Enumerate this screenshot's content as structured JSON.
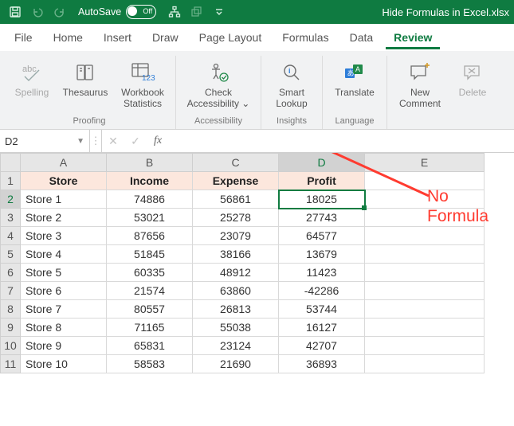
{
  "titlebar": {
    "autosave_label": "AutoSave",
    "autosave_state": "Off",
    "filename": "Hide Formulas in Excel.xlsx"
  },
  "tabs": [
    {
      "id": "file",
      "label": "File"
    },
    {
      "id": "home",
      "label": "Home"
    },
    {
      "id": "insert",
      "label": "Insert"
    },
    {
      "id": "draw",
      "label": "Draw"
    },
    {
      "id": "pagelayout",
      "label": "Page Layout"
    },
    {
      "id": "formulas",
      "label": "Formulas"
    },
    {
      "id": "data",
      "label": "Data"
    },
    {
      "id": "review",
      "label": "Review",
      "active": true
    }
  ],
  "ribbon": {
    "groups": {
      "proofing": {
        "label": "Proofing",
        "spelling": "Spelling",
        "thesaurus": "Thesaurus",
        "workbook_stats": "Workbook\nStatistics"
      },
      "accessibility": {
        "label": "Accessibility",
        "check": "Check\nAccessibility ⌄"
      },
      "insights": {
        "label": "Insights",
        "smartlookup": "Smart\nLookup"
      },
      "language": {
        "label": "Language",
        "translate": "Translate"
      },
      "comments": {
        "newcomment": "New\nComment",
        "delete": "Delete"
      }
    }
  },
  "formula_bar": {
    "cell_ref": "D2",
    "fx_label": "fx",
    "content": ""
  },
  "columns": [
    "A",
    "B",
    "C",
    "D",
    "E"
  ],
  "headers": {
    "A": "Store",
    "B": "Income",
    "C": "Expense",
    "D": "Profit"
  },
  "rows": [
    {
      "n": 2,
      "store": "Store 1",
      "income": 74886,
      "expense": 56861,
      "profit": 18025
    },
    {
      "n": 3,
      "store": "Store 2",
      "income": 53021,
      "expense": 25278,
      "profit": 27743
    },
    {
      "n": 4,
      "store": "Store 3",
      "income": 87656,
      "expense": 23079,
      "profit": 64577
    },
    {
      "n": 5,
      "store": "Store 4",
      "income": 51845,
      "expense": 38166,
      "profit": 13679
    },
    {
      "n": 6,
      "store": "Store 5",
      "income": 60335,
      "expense": 48912,
      "profit": 11423
    },
    {
      "n": 7,
      "store": "Store 6",
      "income": 21574,
      "expense": 63860,
      "profit": -42286
    },
    {
      "n": 8,
      "store": "Store 7",
      "income": 80557,
      "expense": 26813,
      "profit": 53744
    },
    {
      "n": 9,
      "store": "Store 8",
      "income": 71165,
      "expense": 55038,
      "profit": 16127
    },
    {
      "n": 10,
      "store": "Store 9",
      "income": 65831,
      "expense": 23124,
      "profit": 42707
    },
    {
      "n": 11,
      "store": "Store 10",
      "income": 58583,
      "expense": 21690,
      "profit": 36893
    }
  ],
  "selected_cell": "D2",
  "annotation": {
    "line1": "No",
    "line2": "Formula"
  }
}
